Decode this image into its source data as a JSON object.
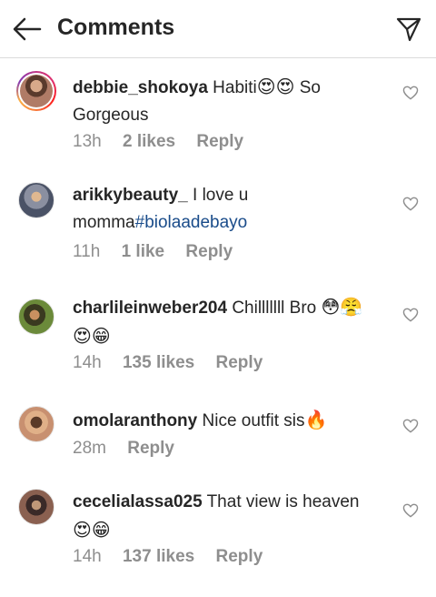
{
  "header": {
    "title": "Comments",
    "back_icon": "arrow-left-icon",
    "share_icon": "paper-plane-icon"
  },
  "comments": [
    {
      "username": "debbie_shokoya",
      "text_before": "Habiti",
      "emojis_mid": "😍😍",
      "text_after": " So Gorgeous",
      "time": "13h",
      "likes": "2 likes",
      "reply": "Reply",
      "avatar_color": "#8a5a48"
    },
    {
      "username": "arikkybeauty_",
      "text_before": "I love u momma",
      "hashtag": "#biolaadebayo",
      "time": "11h",
      "likes": "1 like",
      "reply": "Reply",
      "avatar_color": "#5a6378"
    },
    {
      "username": "charlileinweber204",
      "text_before": "Chilllllll Bro",
      "emojis_end": "😳😤😍😁",
      "time": "14h",
      "likes": "135 likes",
      "reply": "Reply",
      "avatar_color": "#6b5432"
    },
    {
      "username": "omolaranthony",
      "text_before": "Nice outfit sis",
      "emojis_end": "🔥",
      "time": "28m",
      "reply": "Reply",
      "avatar_color": "#c09070"
    },
    {
      "username": "cecelialassa025",
      "text_before": "That view is heaven",
      "emojis_end": "😍😁",
      "time": "14h",
      "likes": "137 likes",
      "reply": "Reply",
      "avatar_color": "#7a5a50"
    }
  ]
}
